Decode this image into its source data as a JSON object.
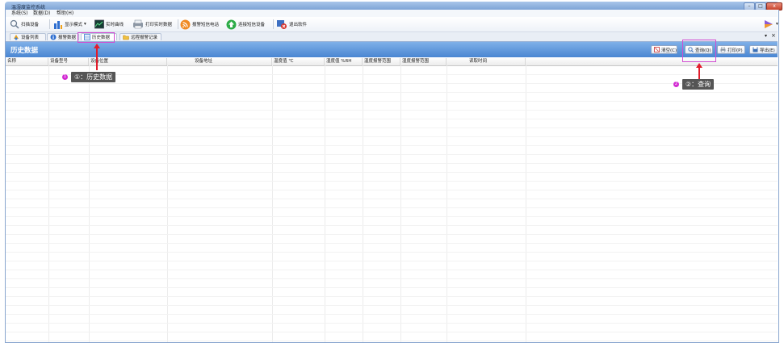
{
  "window": {
    "title": "温湿度监控系统",
    "controls": {
      "minimize": "–",
      "maximize": "□",
      "close": "x"
    }
  },
  "menu": {
    "items": [
      "系统(S)",
      "数据(D)",
      "帮助(H)"
    ]
  },
  "toolbar": {
    "scan": "扫描设备",
    "display_mode": "显示模式",
    "realtime_curve": "实时曲线",
    "print_realtime": "打印实时数据",
    "alarm_sms": "报警短信电话",
    "connect_sms": "连接短信设备",
    "exit": "退出软件"
  },
  "tabs": [
    "设备列表",
    "报警数据",
    "历史数据",
    "远程报警记录"
  ],
  "tab_controls": {
    "pin": "▾",
    "close": "×"
  },
  "panel": {
    "title": "历史数据",
    "buttons": {
      "clear": "清空(C)",
      "query": "查询(Q)",
      "print": "打印(P)",
      "export": "导出(E)"
    }
  },
  "grid": {
    "columns": [
      "名称",
      "设备型号",
      "设备位置",
      "设备地址",
      "温度值 ℃",
      "湿度值 %RH",
      "温度报警范围",
      "湿度报警范围",
      "读取时间"
    ],
    "rows": []
  },
  "annotations": [
    {
      "num": "1",
      "label": "①：历史数据"
    },
    {
      "num": "2",
      "label": "②：查询"
    }
  ],
  "colors": {
    "accent": "#4a86d2",
    "marker": "#d24bd2",
    "arrow": "#e11c2b"
  }
}
